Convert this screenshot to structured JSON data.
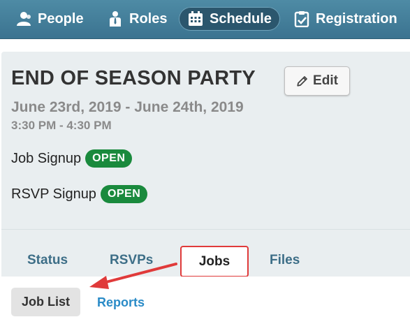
{
  "nav": {
    "people": "People",
    "roles": "Roles",
    "schedule": "Schedule",
    "registration": "Registration"
  },
  "event": {
    "title": "END OF SEASON PARTY",
    "edit_label": "Edit",
    "date_range": "June 23rd, 2019 - June 24th, 2019",
    "time_range": "3:30 PM - 4:30 PM",
    "job_signup_label": "Job Signup",
    "job_signup_status": "OPEN",
    "rsvp_signup_label": "RSVP Signup",
    "rsvp_signup_status": "OPEN"
  },
  "tabs": {
    "status": "Status",
    "rsvps": "RSVPs",
    "jobs": "Jobs",
    "files": "Files"
  },
  "subtabs": {
    "job_list": "Job List",
    "reports": "Reports"
  },
  "colors": {
    "nav_bg": "#4e8ba5",
    "badge_green": "#1a8a3d",
    "highlight_red": "#e03a3a",
    "link_blue": "#2a8bc7"
  }
}
